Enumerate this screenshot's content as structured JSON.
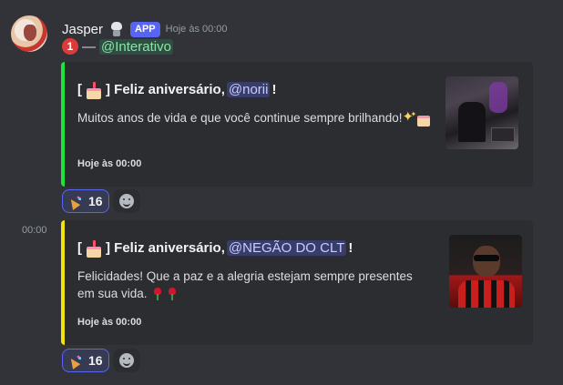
{
  "author": {
    "username": "Jasper",
    "app_badge": "APP",
    "timestamp": "Hoje às 00:00"
  },
  "message": {
    "number_badge": "1",
    "dash": "—",
    "mention": "@Interativo"
  },
  "embeds": [
    {
      "accent_color": "#1ee33a",
      "title_open": "[",
      "title_close": "] Feliz aniversário,",
      "title_mention": "@norii",
      "title_end": "!",
      "description": "Muitos anos de vida e que você continue sempre brilhando!",
      "footer": "Hoje às 00:00"
    },
    {
      "accent_color": "#f2e30c",
      "title_open": "[",
      "title_close": "] Feliz aniversário,",
      "title_mention": "@NEGÃO DO CLT",
      "title_end": "!",
      "description": "Felicidades! Que a paz e a alegria estejam sempre presentes em sua vida.",
      "footer": "Hoje às 00:00"
    }
  ],
  "reactions": [
    {
      "emoji": "party-popper-icon",
      "count": "16"
    },
    {
      "emoji": "party-popper-icon",
      "count": "16"
    }
  ],
  "second_message_time": "00:00",
  "colors": {
    "background": "#313338",
    "embed_bg": "#2b2d31",
    "blurple": "#5865f2"
  }
}
